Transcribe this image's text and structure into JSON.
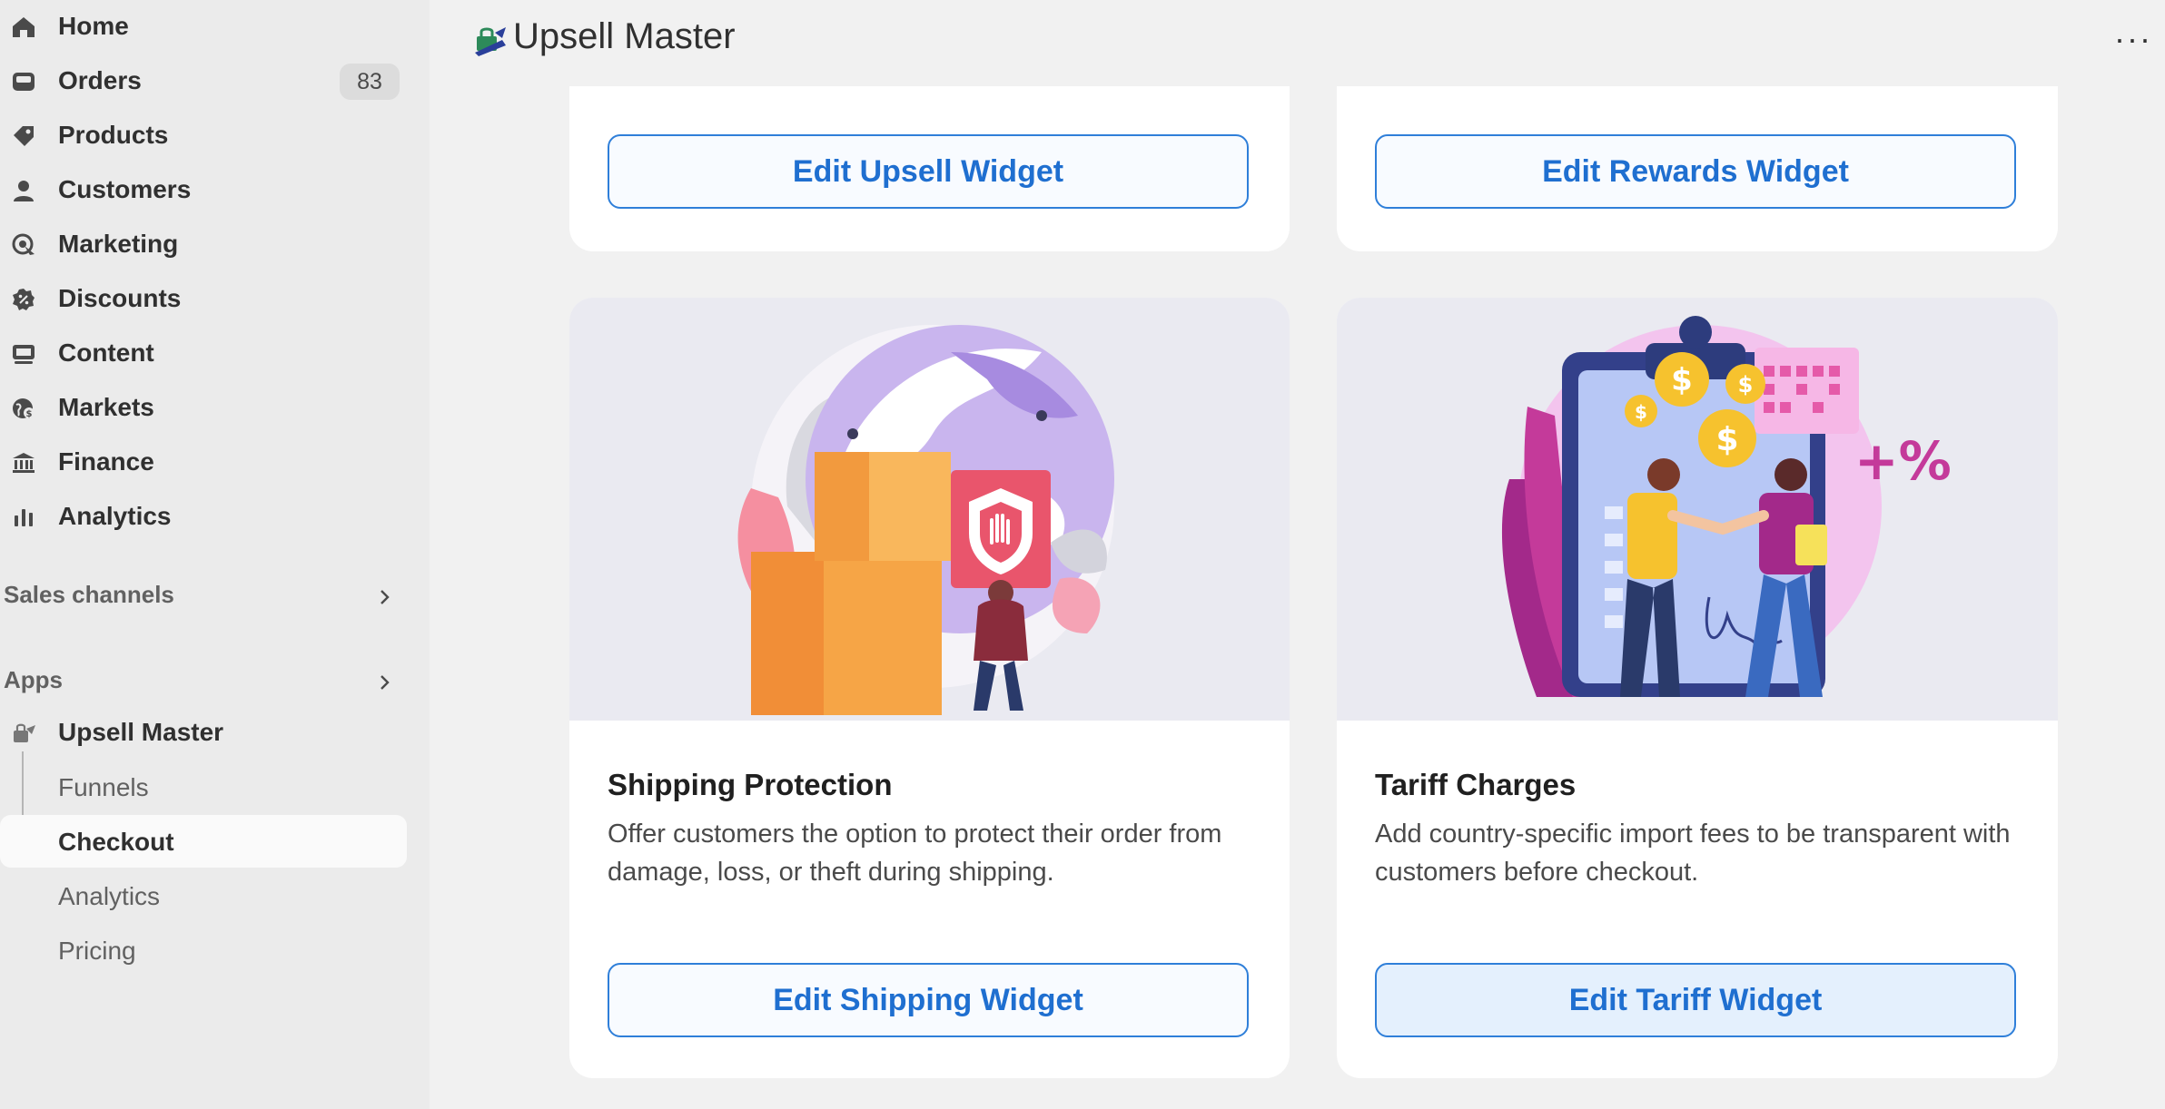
{
  "sidebar": {
    "nav": [
      {
        "label": "Home",
        "icon": "home-icon"
      },
      {
        "label": "Orders",
        "icon": "inbox-icon",
        "badge": "83"
      },
      {
        "label": "Products",
        "icon": "tag-icon"
      },
      {
        "label": "Customers",
        "icon": "person-icon"
      },
      {
        "label": "Marketing",
        "icon": "target-icon"
      },
      {
        "label": "Discounts",
        "icon": "discount-icon"
      },
      {
        "label": "Content",
        "icon": "content-icon"
      },
      {
        "label": "Markets",
        "icon": "globe-icon"
      },
      {
        "label": "Finance",
        "icon": "bank-icon"
      },
      {
        "label": "Analytics",
        "icon": "bar-chart-icon"
      }
    ],
    "sales_channels": "Sales channels",
    "apps": "Apps",
    "app_name": "Upsell Master",
    "app_sub": [
      {
        "label": "Funnels"
      },
      {
        "label": "Checkout",
        "active": true
      },
      {
        "label": "Analytics"
      },
      {
        "label": "Pricing"
      }
    ]
  },
  "header": {
    "title": "Upsell Master",
    "menu": "···"
  },
  "main": {
    "top_buttons": [
      "Edit Upsell Widget",
      "Edit Rewards Widget"
    ],
    "cards": [
      {
        "title": "Shipping Protection",
        "desc": "Offer customers the option to protect their order from damage, loss, or theft during shipping.",
        "button": "Edit Shipping Widget",
        "illustration": "shipping-protection-illustration"
      },
      {
        "title": "Tariff Charges",
        "desc": "Add country-specific import fees to be transparent with customers before checkout.",
        "button": "Edit Tariff Widget",
        "illustration": "tariff-charges-illustration"
      }
    ]
  },
  "colors": {
    "accent": "#1f6fd0",
    "sidebar_bg": "#ebebeb",
    "page_bg": "#f1f1f1"
  }
}
